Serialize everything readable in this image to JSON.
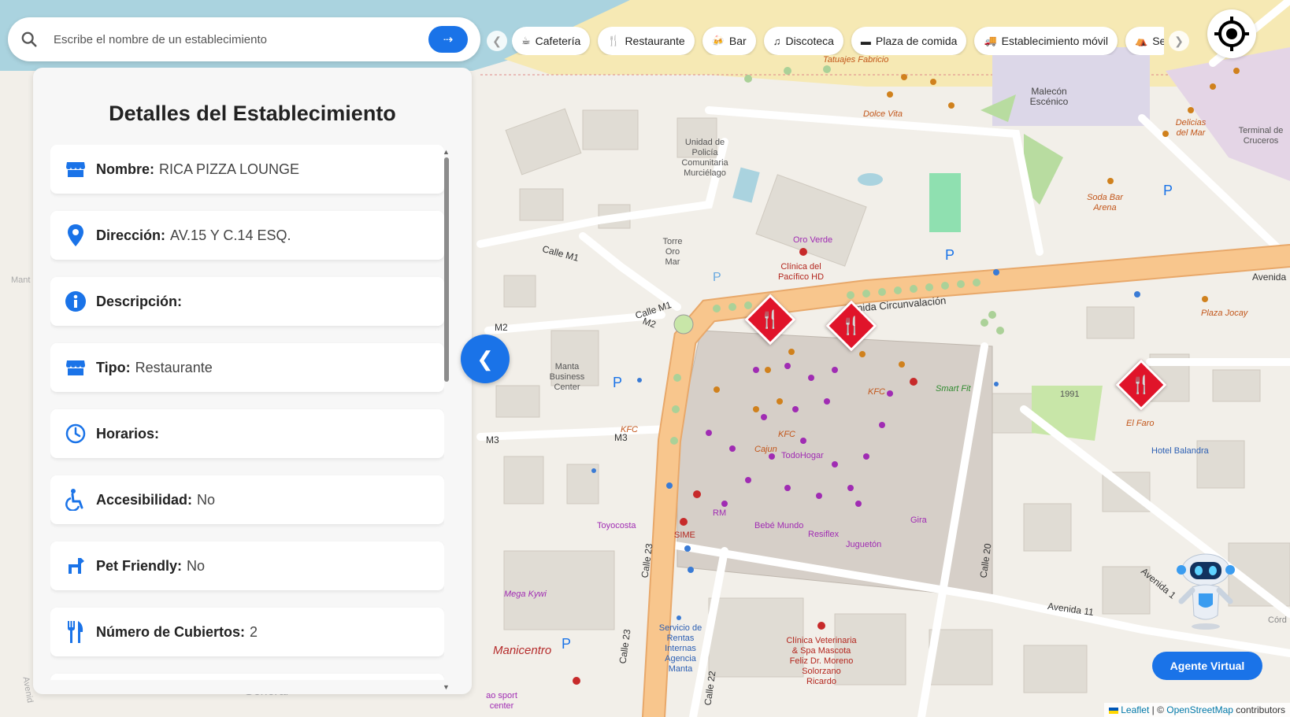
{
  "search": {
    "placeholder": "Escribe el nombre de un establecimiento",
    "icon": "search-icon",
    "route_icon": "directions-icon"
  },
  "details": {
    "title": "Detalles del Establecimiento",
    "fields": [
      {
        "label": "Nombre:",
        "value": "RICA PIZZA LOUNGE",
        "icon": "store-icon"
      },
      {
        "label": "Dirección:",
        "value": "AV.15 Y C.14 ESQ.",
        "icon": "location-pin-icon"
      },
      {
        "label": "Descripción:",
        "value": "",
        "icon": "info-icon"
      },
      {
        "label": "Tipo:",
        "value": "Restaurante",
        "icon": "store-icon"
      },
      {
        "label": "Horarios:",
        "value": "",
        "icon": "clock-icon"
      },
      {
        "label": "Accesibilidad:",
        "value": "No",
        "icon": "wheelchair-icon"
      },
      {
        "label": "Pet Friendly:",
        "value": "No",
        "icon": "dog-icon"
      },
      {
        "label": "Número de Cubiertos:",
        "value": "2",
        "icon": "cutlery-icon"
      }
    ]
  },
  "categories": [
    {
      "label": "Cafetería",
      "icon": "coffee-icon"
    },
    {
      "label": "Restaurante",
      "icon": "cutlery-icon"
    },
    {
      "label": "Bar",
      "icon": "beer-icon"
    },
    {
      "label": "Discoteca",
      "icon": "music-icon"
    },
    {
      "label": "Plaza de comida",
      "icon": "food-court-icon"
    },
    {
      "label": "Establecimiento móvil",
      "icon": "truck-icon"
    },
    {
      "label": "Se",
      "icon": "tent-icon"
    }
  ],
  "map": {
    "labels": {
      "tatuajes": "Tatuajes Fabricio",
      "malecon": "Malecón Escénico",
      "dolce": "Dolce Vita",
      "delicias": "Delicias del Mar",
      "terminal": "Terminal de Cruceros",
      "upc": "Unidad de Policía Comunitaria Murciélago",
      "soda": "Soda Bar Arena",
      "oro_verde": "Oro Verde",
      "clinica_pacifico": "Clínica del Pacífico HD",
      "torre": "Torre Oro Mar",
      "calle_m1_a": "Calle M1",
      "calle_m1_b": "Calle M1",
      "m2_a": "M2",
      "m2_b": "M2",
      "m3_a": "M3",
      "m3_b": "M3",
      "avenida": "Avenida",
      "circunvalacion": "nida Circunvalación",
      "plaza_jocay": "Plaza Jocay",
      "manta_bc": "Manta Business Center",
      "smart_fit": "Smart Fit",
      "kfc_a": "KFC",
      "kfc_b": "KFC",
      "kfc_c": "KFC",
      "cajun": "Cajun",
      "todohogar": "TodoHogar",
      "year": "1991",
      "el_faro": "El Faro",
      "hotel": "Hotel Balandra",
      "toyocosta": "Toyocosta",
      "rm": "RM",
      "sime": "SIME",
      "bebe": "Bebé Mundo",
      "resiflex": "Resiflex",
      "jugueton": "Juguetón",
      "gira": "Gira",
      "calle_23_a": "Calle 23",
      "calle_23_b": "Calle 23",
      "calle_20": "Calle 20",
      "calle_22": "Calle 22",
      "avenida_11": "Avenida 11",
      "avenida_1": "Avenida 1",
      "mega_kywi": "Mega Kywi",
      "manicentro": "Manicentro",
      "servicio": "Servicio de Rentas Internas Agencia Manta",
      "clinica_vet": "Clínica Veterinaria & Spa Mascota Feliz Dr. Moreno Solorzano Ricardo",
      "general": "General",
      "sport": "ao sport center",
      "manta_left": "Mant",
      "avenida_left": "Avenid",
      "cord": "Córd"
    }
  },
  "assistant": {
    "button_label": "Agente Virtual"
  },
  "attribution": {
    "leaflet": "Leaflet",
    "separator": " | © ",
    "osm": "OpenStreetMap",
    "suffix": " contributors"
  },
  "colors": {
    "accent": "#1a73e8",
    "marker": "#e0142a",
    "road_major": "#f8c68d",
    "sea": "#aad3df",
    "beach": "#f6e9b4"
  }
}
